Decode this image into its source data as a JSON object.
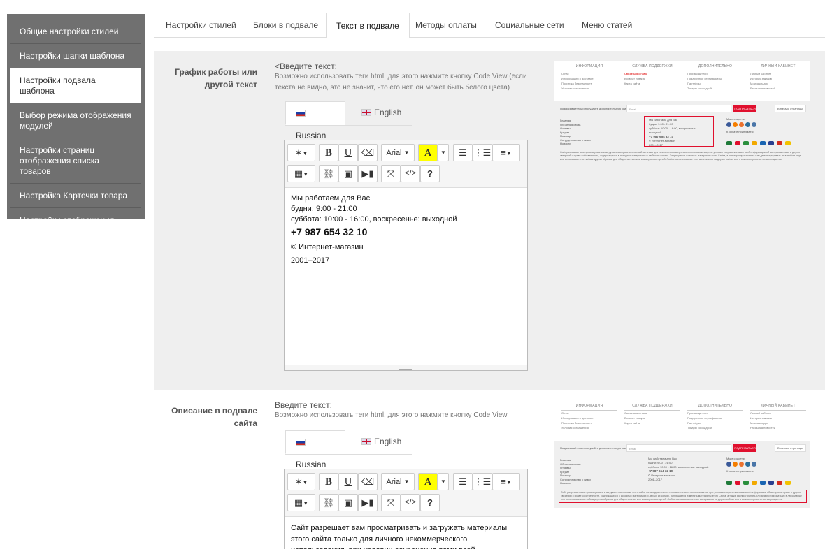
{
  "sidebar": {
    "items": [
      {
        "label": "Общие настройки стилей",
        "active": false
      },
      {
        "label": "Настройки шапки шаблона",
        "active": false
      },
      {
        "label": "Настройки подвала шаблона",
        "active": true
      },
      {
        "label": "Выбор режима отображения модулей",
        "active": false
      },
      {
        "label": "Настройки страниц отображения списка товаров",
        "active": false
      },
      {
        "label": "Настройка Карточки товара",
        "active": false
      },
      {
        "label": "Настройки отображения стикеров",
        "active": false
      }
    ]
  },
  "tabs": [
    {
      "label": "Настройки стилей"
    },
    {
      "label": "Блоки в подвале"
    },
    {
      "label": "Текст в подвале",
      "active": true
    },
    {
      "label": "Методы оплаты"
    },
    {
      "label": "Социальные сети"
    },
    {
      "label": "Меню статей"
    }
  ],
  "section1": {
    "label": "График работы или другой текст",
    "hint_title": "<Введите текст:",
    "hint_text": "Возможно использовать теги html, для этого нажмите кнопку Code View (если текста не видно, это не значит, что его нет, он может быть белого цвета)",
    "lang_ru": "Russian",
    "lang_en": "English",
    "font_name": "Arial",
    "editor": {
      "line1": "Мы работаем для Вас",
      "line2": "будни: 9:00 - 21:00",
      "line3": "суббота: 10:00 - 16:00, воскресенье: выходной",
      "phone": "+7 987 654 32 10",
      "line5": "© Интернет-магазин",
      "line6": "2001–2017"
    }
  },
  "section2": {
    "label": "Описание в подвале сайта",
    "hint_title": "Введите текст:",
    "hint_text": "Возможно использовать теги html, для этого нажмите кнопку Code View",
    "lang_ru": "Russian",
    "lang_en": "English",
    "font_name": "Arial",
    "editor": {
      "text": "Сайт разрешает вам просматривать и загружать материалы этого сайта только для личного некоммерческого использования, при условии сохранения вами всей информации об авторском праве и"
    }
  },
  "preview": {
    "col_headers": [
      "ИНФОРМАЦИЯ",
      "СЛУЖБА ПОДДЕРЖКИ",
      "ДОПОЛНИТЕЛЬНО",
      "ЛИЧНЫЙ КАБИНЕТ"
    ],
    "col1": [
      "О нас",
      "Информация о доставке",
      "Политика безопасности",
      "Условия соглашения"
    ],
    "col2": [
      "Связаться с нами",
      "Возврат товара",
      "Карта сайта"
    ],
    "col3": [
      "Производители",
      "Подарочные сертификаты",
      "Партнёры",
      "Товары со скидкой"
    ],
    "col4": [
      "Личный кабинет",
      "История заказов",
      "Мои закладки",
      "Рассылка новостей"
    ],
    "subscribe": "Подписывайтесь и получайте дополнительную скидку",
    "email_ph": "Email",
    "subscribe_btn": "ПОДПИСАТЬСЯ",
    "top_select": "В начало страницы",
    "links": [
      "Главная",
      "Обратная связь",
      "Отзывы",
      "Кредит",
      "Помощь",
      "Сотрудничество с нами",
      "Новости"
    ],
    "contact": [
      "Мы работаем для Вас",
      "будни: 9:00 - 21:00",
      "суббота: 10:00 - 16:00, воскресенье: выходной",
      "+7 987 654 32 10",
      "© Интернет-магазин",
      "2001–2017"
    ],
    "social_title": "Мы в соцсетях",
    "pay_title": "К оплате принимаем",
    "copy": "Сайт разрешает вам просматривать и загружать материалы этого сайта только для личного некоммерческого использования, при условии сохранения вами всей информации об авторском праве и других сведений о праве собственности, содержащихся в исходных материалах и любых их копиях. Запрещается изменять материалы этого Сайта, а также распространять или демонстрировать их в любом виде или использовать их любым другим образом для общественных или коммерческих целей. Любое использование этих материалов на других сайтах или в компьютерных сетях запрещается.",
    "colors": {
      "social": [
        "#3b5998",
        "#f57e00",
        "#eb722e",
        "#2c6e9b",
        "#4a76a8"
      ],
      "pay": [
        "#1f7a3a",
        "#e0102e",
        "#2a8f3d",
        "#f2a900",
        "#1a65b2",
        "#2a3f8f",
        "#d52b1e",
        "#f2c200"
      ]
    }
  }
}
